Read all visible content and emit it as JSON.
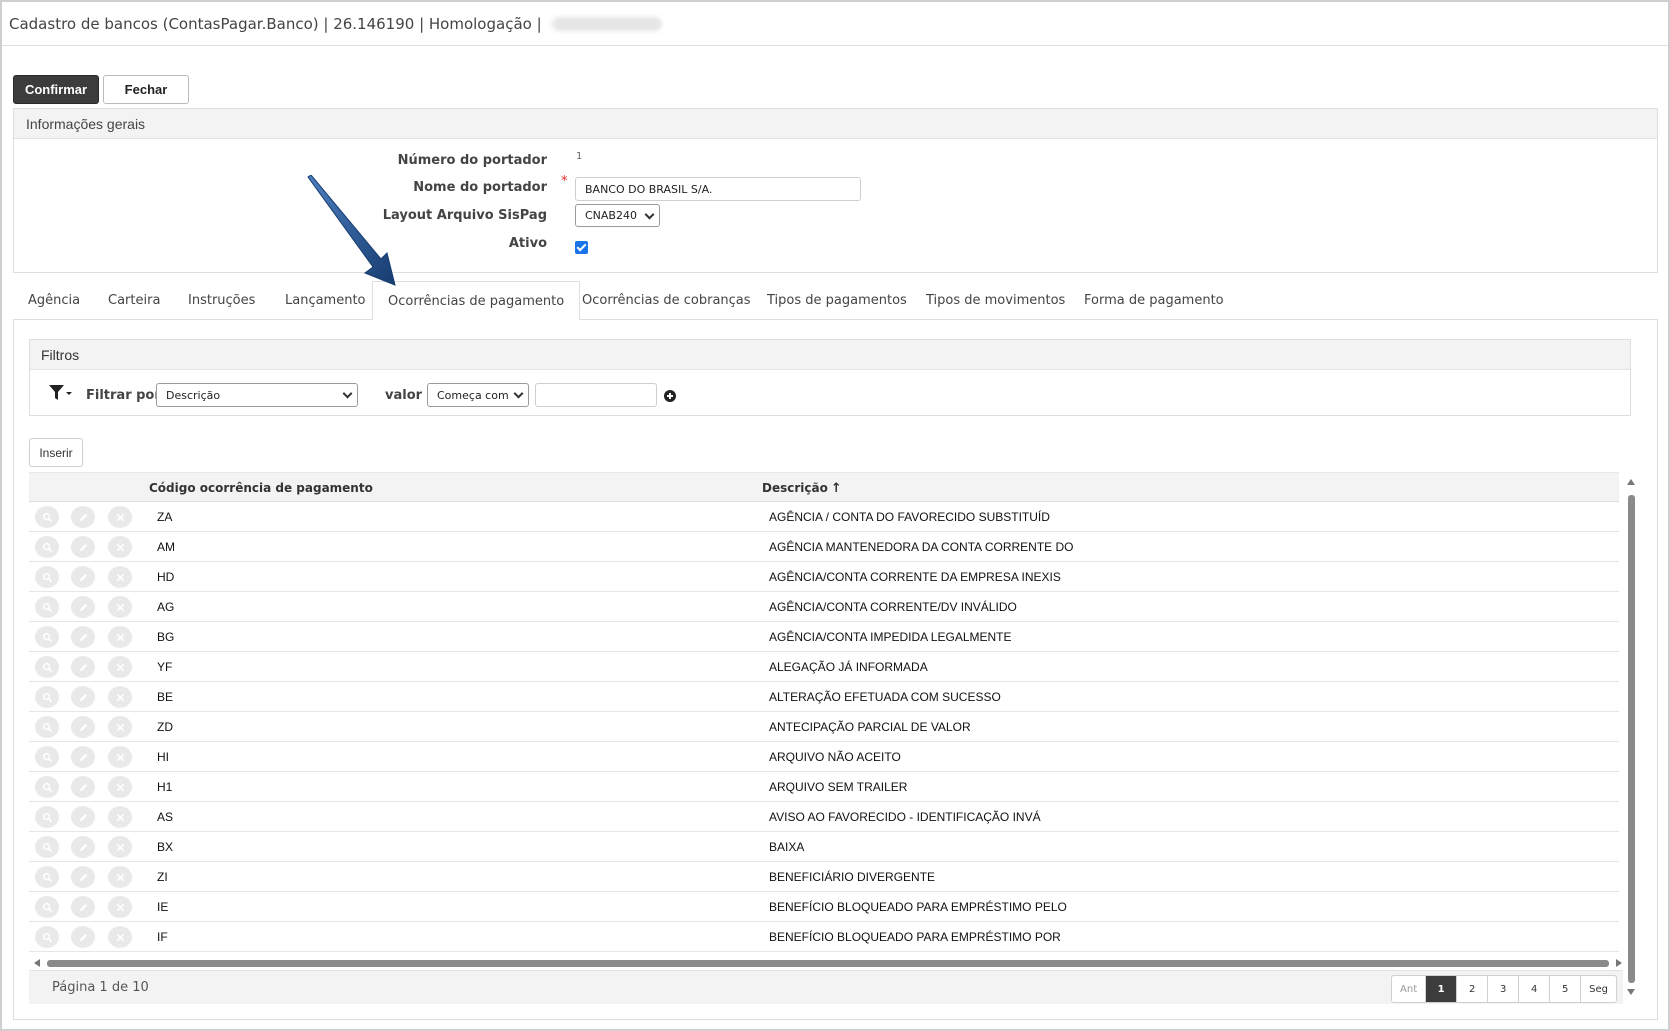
{
  "window": {
    "title": "Cadastro de bancos (ContasPagar.Banco) | 26.146190 | Homologação |"
  },
  "toolbar": {
    "confirm_label": "Confirmar",
    "close_label": "Fechar"
  },
  "general_info": {
    "header": "Informações gerais",
    "number_label": "Número do portador",
    "number_value": "1",
    "name_label": "Nome do portador",
    "name_value": "BANCO DO BRASIL S/A.",
    "required_mark": "*",
    "layout_label": "Layout Arquivo SisPag",
    "layout_value": "CNAB240",
    "active_label": "Ativo",
    "active_checked": true
  },
  "tabs": [
    {
      "label": "Agência",
      "active": false
    },
    {
      "label": "Carteira",
      "active": false
    },
    {
      "label": "Instruções",
      "active": false
    },
    {
      "label": "Lançamento",
      "active": false
    },
    {
      "label": "Ocorrências de pagamento",
      "active": true
    },
    {
      "label": "Ocorrências de cobranças",
      "active": false
    },
    {
      "label": "Tipos de pagamentos",
      "active": false
    },
    {
      "label": "Tipos de movimentos",
      "active": false
    },
    {
      "label": "Forma de pagamento",
      "active": false
    }
  ],
  "filters": {
    "header": "Filtros",
    "filter_by_label": "Filtrar por",
    "field_value": "Descrição",
    "value_label": "valor",
    "operator_value": "Começa com",
    "input_value": ""
  },
  "insert_label": "Inserir",
  "grid": {
    "columns": [
      "Código ocorrência de pagamento",
      "Descrição"
    ],
    "sort_indicator": "↑",
    "rows": [
      {
        "code": "ZA",
        "desc": "AGÊNCIA / CONTA DO FAVORECIDO SUBSTITUÍD"
      },
      {
        "code": "AM",
        "desc": "AGÊNCIA MANTENEDORA DA CONTA CORRENTE DO"
      },
      {
        "code": "HD",
        "desc": "AGÊNCIA/CONTA CORRENTE DA EMPRESA INEXIS"
      },
      {
        "code": "AG",
        "desc": "AGÊNCIA/CONTA CORRENTE/DV INVÁLIDO"
      },
      {
        "code": "BG",
        "desc": "AGÊNCIA/CONTA IMPEDIDA LEGALMENTE"
      },
      {
        "code": "YF",
        "desc": "ALEGAÇÃO JÁ INFORMADA"
      },
      {
        "code": "BE",
        "desc": "ALTERAÇÃO EFETUADA COM SUCESSO"
      },
      {
        "code": "ZD",
        "desc": "ANTECIPAÇÃO PARCIAL DE VALOR"
      },
      {
        "code": "HI",
        "desc": "ARQUIVO NÃO ACEITO"
      },
      {
        "code": "H1",
        "desc": "ARQUIVO SEM TRAILER"
      },
      {
        "code": "AS",
        "desc": "AVISO AO FAVORECIDO - IDENTIFICAÇÃO INVÁ"
      },
      {
        "code": "BX",
        "desc": "BAIXA"
      },
      {
        "code": "ZI",
        "desc": "BENEFICIÁRIO DIVERGENTE"
      },
      {
        "code": "IE",
        "desc": "BENEFÍCIO BLOQUEADO PARA EMPRÉSTIMO PELO"
      },
      {
        "code": "IF",
        "desc": "BENEFÍCIO BLOQUEADO PARA EMPRÉSTIMO POR"
      }
    ]
  },
  "pagination": {
    "info": "Página 1 de 10",
    "prev_label": "Ant",
    "next_label": "Seg",
    "pages": [
      "1",
      "2",
      "3",
      "4",
      "5"
    ],
    "current": "1"
  },
  "colors": {
    "primary_button": "#3c3c3c",
    "required": "#d9261c",
    "checkbox": "#1a73e8",
    "annotation_arrow": "#1f4e8c"
  }
}
